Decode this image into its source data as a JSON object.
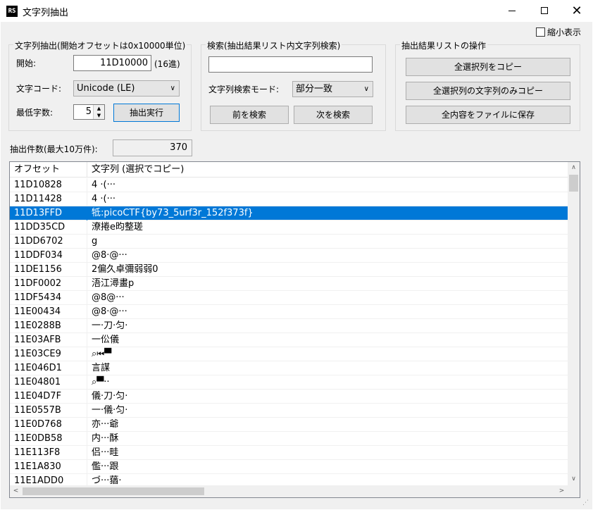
{
  "window": {
    "icon_text": "RS",
    "title": "文字列抽出",
    "minimize_glyph": "",
    "close_glyph": "✕"
  },
  "options": {
    "shrink_label": "縮小表示",
    "shrink_checked": false
  },
  "extract_group": {
    "legend": "文字列抽出(開始オフセットは0x10000単位)",
    "start_label": "開始:",
    "start_value": "11D10000",
    "hex_note": "(16進)",
    "encoding_label": "文字コード:",
    "encoding_value": "Unicode (LE)",
    "min_len_label": "最低字数:",
    "min_len_value": "5",
    "run_button": "抽出実行"
  },
  "search_group": {
    "legend": "検索(抽出結果リスト内文字列検索)",
    "search_value": "",
    "mode_label": "文字列検索モード:",
    "mode_value": "部分一致",
    "prev_button": "前を検索",
    "next_button": "次を検索"
  },
  "ops_group": {
    "legend": "抽出結果リストの操作",
    "copy_all_button": "全選択列をコピー",
    "copy_strings_button": "全選択列の文字列のみコピー",
    "save_button": "全内容をファイルに保存"
  },
  "count": {
    "label": "抽出件数(最大10万件):",
    "value": "370"
  },
  "list": {
    "columns": [
      "オフセット",
      "文字列 (選択でコピー)"
    ],
    "selected_index": 2,
    "rows": [
      {
        "offset": "11D10828",
        "text": "4 ·(···"
      },
      {
        "offset": "11D11428",
        "text": "4 ·(···"
      },
      {
        "offset": "11D13FFD",
        "text": "牴:picoCTF{by73_5urf3r_152f373f}"
      },
      {
        "offset": "11DD35CD",
        "text": "潦捲e昀整瑳"
      },
      {
        "offset": "11DD6702",
        "text": "g"
      },
      {
        "offset": "11DDF034",
        "text": "@8·@···"
      },
      {
        "offset": "11DE1156",
        "text": "2偏久卓彌弱弱0"
      },
      {
        "offset": "11DF0002",
        "text": "浯江潯畫p"
      },
      {
        "offset": "11DF5434",
        "text": "@8@···"
      },
      {
        "offset": "11E00434",
        "text": "@8·@···"
      },
      {
        "offset": "11E0288B",
        "text": "一·刀·匀·"
      },
      {
        "offset": "11E03AFB",
        "text": "一伀儀"
      },
      {
        "offset": "11E03CE9",
        "text": "⌕⏮▀"
      },
      {
        "offset": "11E046D1",
        "text": "言謀"
      },
      {
        "offset": "11E04801",
        "text": "⌕▀··"
      },
      {
        "offset": "11E04D7F",
        "text": "儀·刀·匀·"
      },
      {
        "offset": "11E0557B",
        "text": "一·儀·匀·"
      },
      {
        "offset": "11E0D768",
        "text": "亦···爺"
      },
      {
        "offset": "11E0DB58",
        "text": "内···酥"
      },
      {
        "offset": "11E113F8",
        "text": "侣···畦"
      },
      {
        "offset": "11E1A830",
        "text": "儖···跟"
      },
      {
        "offset": "11E1ADD0",
        "text": "づ···蕕·"
      }
    ]
  }
}
